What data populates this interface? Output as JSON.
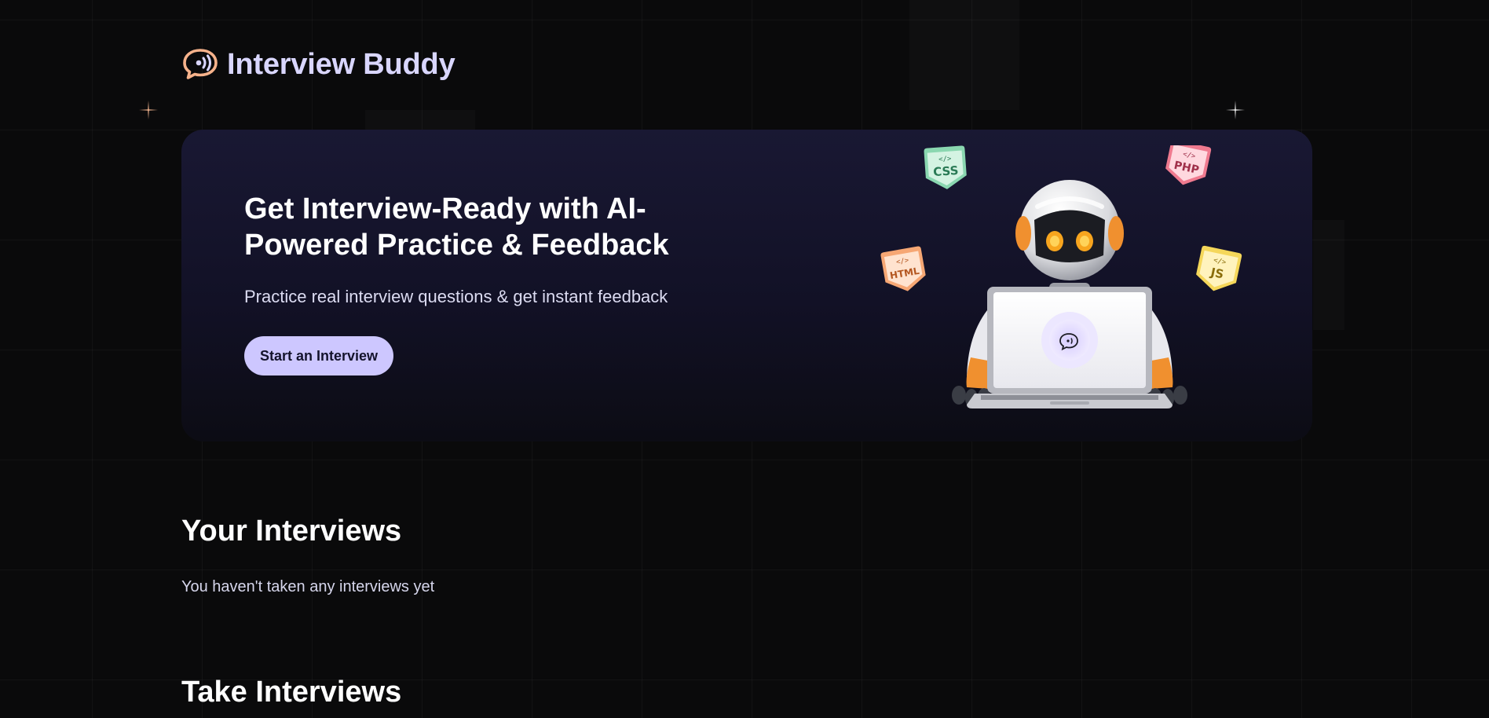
{
  "header": {
    "app_name": "Interview Buddy"
  },
  "hero": {
    "title": "Get Interview-Ready with AI-Powered Practice & Feedback",
    "subtitle": "Practice real interview questions & get instant feedback",
    "cta_label": "Start an Interview",
    "badges": [
      "CSS",
      "PHP",
      "HTML",
      "JS"
    ]
  },
  "your_interviews": {
    "title": "Your Interviews",
    "empty_text": "You haven't taken any interviews yet"
  },
  "take_interviews": {
    "title": "Take Interviews"
  },
  "colors": {
    "background": "#0a0a0b",
    "brand_text": "#d9d6ff",
    "logo_accent": "#f6b28b",
    "cta_background": "#cdc7ff",
    "hero_gradient_top": "#191833"
  },
  "icons": {
    "logo": "chat-bubble-sound-icon"
  }
}
